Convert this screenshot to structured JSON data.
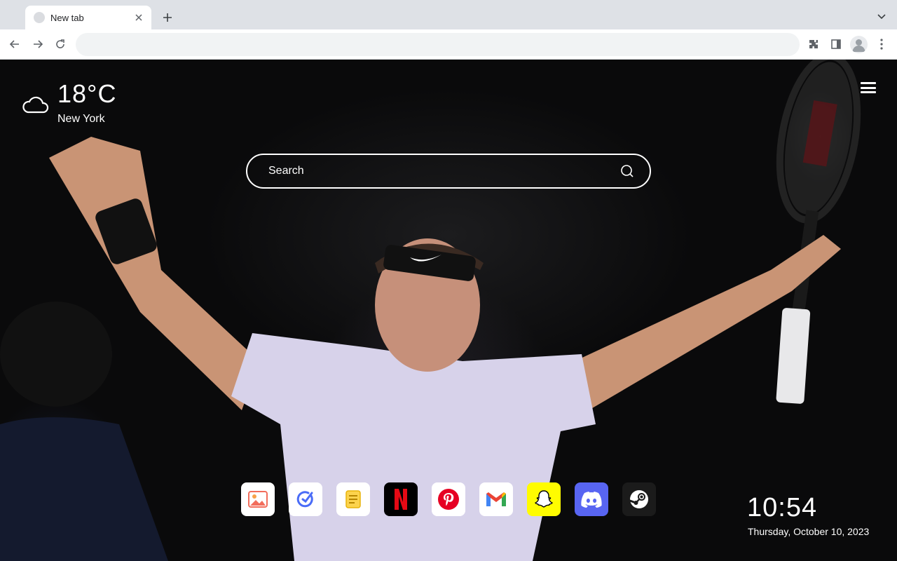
{
  "browser": {
    "tab": {
      "title": "New tab"
    },
    "omnibox": {
      "value": ""
    }
  },
  "weather": {
    "temperature": "18°C",
    "city": "New York",
    "icon": "cloud-icon"
  },
  "search": {
    "placeholder": "Search"
  },
  "dock": {
    "apps": [
      {
        "name": "photos",
        "icon": "photos-icon",
        "bg": "#ffffff"
      },
      {
        "name": "task",
        "icon": "check-icon",
        "bg": "#ffffff"
      },
      {
        "name": "notes",
        "icon": "notes-icon",
        "bg": "#ffffff"
      },
      {
        "name": "netflix",
        "icon": "netflix-icon",
        "bg": "#000000"
      },
      {
        "name": "pinterest",
        "icon": "pinterest-icon",
        "bg": "#ffffff"
      },
      {
        "name": "gmail",
        "icon": "gmail-icon",
        "bg": "#ffffff"
      },
      {
        "name": "snapchat",
        "icon": "snapchat-icon",
        "bg": "#fffc00"
      },
      {
        "name": "discord",
        "icon": "discord-icon",
        "bg": "#5865f2"
      },
      {
        "name": "steam",
        "icon": "steam-icon",
        "bg": "#1b1b1b"
      }
    ]
  },
  "clock": {
    "time": "10:54",
    "date": "Thursday, October 10, 2023"
  },
  "colors": {
    "netflix": "#e50914",
    "pinterest": "#e60023",
    "gmail_red": "#ea4335",
    "discord": "#5865f2",
    "snapchat": "#fffc00"
  }
}
